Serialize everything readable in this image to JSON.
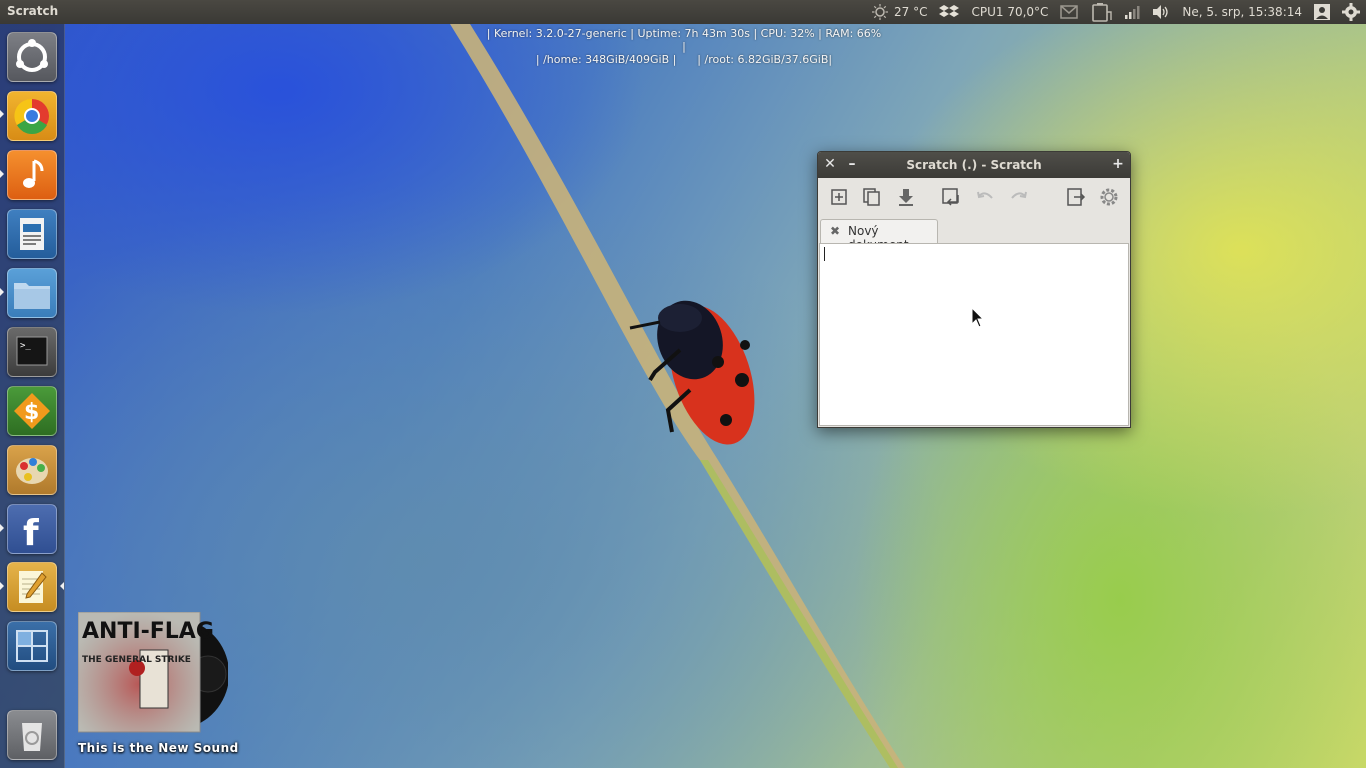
{
  "panel": {
    "app_title": "Scratch",
    "weather": "27 °C",
    "cpu_temp": "CPU1 70,0°C",
    "datetime": "Ne,  5. srp, 15:38:14"
  },
  "conky": {
    "line1": "| Kernel: 3.2.0-27-generic | Uptime: 7h 43m 30s | CPU: 32% | RAM: 66% |",
    "line2": "| /home: 348GiB/409GiB |      | /root: 6.82GiB/37.6GiB|"
  },
  "launcher": {
    "items": [
      {
        "name": "ubuntu-dash",
        "icon": "ubuntu-logo-icon"
      },
      {
        "name": "chromium",
        "icon": "chrome-icon",
        "running": true
      },
      {
        "name": "music-player",
        "icon": "music-note-icon",
        "running": true
      },
      {
        "name": "libreoffice-writer",
        "icon": "writer-icon"
      },
      {
        "name": "files",
        "icon": "folder-icon",
        "running": true
      },
      {
        "name": "terminal",
        "icon": "terminal-icon"
      },
      {
        "name": "finance",
        "icon": "dollar-icon"
      },
      {
        "name": "paint",
        "icon": "palette-icon"
      },
      {
        "name": "facebook",
        "icon": "facebook-icon",
        "running": true
      },
      {
        "name": "scratch-editor",
        "icon": "notepad-icon",
        "running": true,
        "focused": true
      },
      {
        "name": "workspaces",
        "icon": "workspace-switcher-icon"
      },
      {
        "name": "trash",
        "icon": "trash-icon"
      }
    ]
  },
  "window": {
    "title": "Scratch (.) - Scratch",
    "close": "✕",
    "minimize": "–",
    "maximize": "+",
    "tab_label": "Nový dokument",
    "tab_close": "✖"
  },
  "music": {
    "album_title": "ANTI-FLAG",
    "album_subtitle": "THE GENERAL STRIKE",
    "caption": "This is the New Sound"
  },
  "colors": {
    "panel": "#3c3b37",
    "panel_text": "#dfdbd2",
    "window_bg": "#e6e4e0",
    "ladybug_red": "#e03a22"
  }
}
